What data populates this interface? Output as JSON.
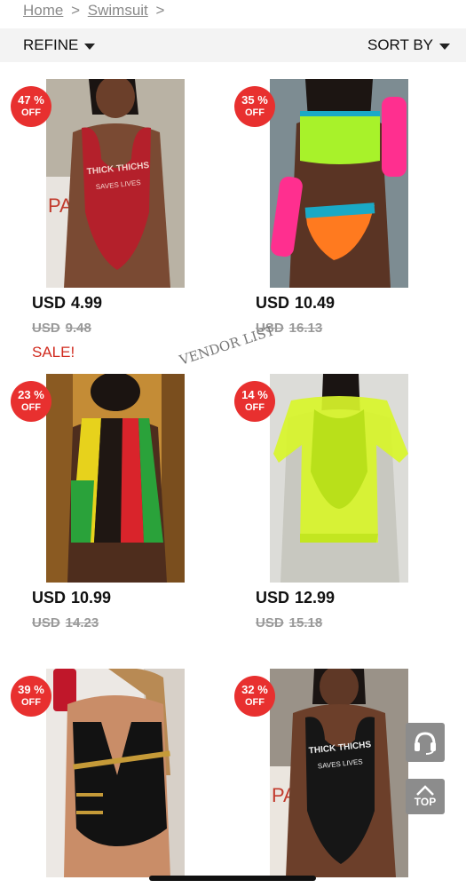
{
  "breadcrumb": {
    "home": "Home",
    "sep": ">",
    "current": "Swimsuit",
    "trail": ">"
  },
  "toolbar": {
    "refine": "REFINE",
    "sort": "SORT BY"
  },
  "watermark": "VENDOR LIST",
  "products": [
    {
      "discount": "47 %",
      "off": "OFF",
      "price_currency": "USD",
      "price": "4.99",
      "old_currency": "USD",
      "old_price": "9.48",
      "sale": "SALE!",
      "print": "THICK THICHS",
      "print2": "SAVES LIVES"
    },
    {
      "discount": "35 %",
      "off": "OFF",
      "price_currency": "USD",
      "price": "10.49",
      "old_currency": "USD",
      "old_price": "16.13"
    },
    {
      "discount": "23 %",
      "off": "OFF",
      "price_currency": "USD",
      "price": "10.99",
      "old_currency": "USD",
      "old_price": "14.23"
    },
    {
      "discount": "14 %",
      "off": "OFF",
      "price_currency": "USD",
      "price": "12.99",
      "old_currency": "USD",
      "old_price": "15.18"
    },
    {
      "discount": "39 %",
      "off": "OFF"
    },
    {
      "discount": "32 %",
      "off": "OFF",
      "print": "THICK THICHS",
      "print2": "SAVES LIVES"
    }
  ],
  "float": {
    "top": "TOP",
    "support_icon": "headset-icon"
  },
  "colors": {
    "badge": "#e8302f",
    "sale": "#d12b1f"
  }
}
